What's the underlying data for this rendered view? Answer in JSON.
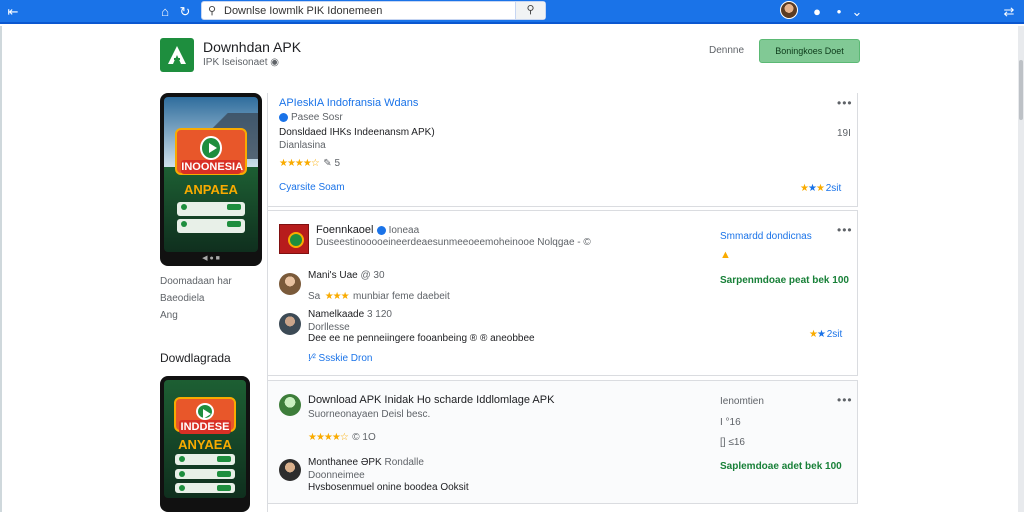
{
  "browser": {
    "back_icon": "back-arrow-icon",
    "search_query": "Downlse Iowmlk PIK Idonemeen",
    "search_icon": "search-icon"
  },
  "header": {
    "app_title": "Downhdan APK",
    "app_subtitle": "IPK Iseisonaet",
    "developer_label": "Dennne",
    "install_label": "Boningkoes Doet"
  },
  "sidebar": {
    "phone1": {
      "badge_text": "INOONESIA",
      "bottom_text": "ANPAEA"
    },
    "phone2": {
      "badge_text": "INDDESE",
      "bottom_text": "ANYAEA"
    },
    "meta": [
      "Doomadaan har",
      "Baeodiela",
      "Ang"
    ],
    "downloads_heading": "Dowdlagrada"
  },
  "card1": {
    "title": "APIeskIA Indofransia Wdans",
    "tag": "Pasee Sosr",
    "subtitle": "Donsldaed IHKs Indeenansm APK)",
    "detail": "Dianlasina",
    "rating_count": "5",
    "link": "Cyarsite Soam",
    "size": "19I",
    "score_label": "2sit"
  },
  "card2": {
    "publisher": "Foennkaoel",
    "publisher_tag": "Ioneaa",
    "description": "Duseestinooooeineerdeaesunmeeoeemoheinooe Nolqgae - ©",
    "side_label": "Smmardd dondicnas",
    "reviews": [
      {
        "name": "Mani's Uae",
        "meta": "@ 30",
        "stars_text": "Sa",
        "text": "munbiar feme daebeit"
      },
      {
        "name": "Namelkaade",
        "meta": "3 120",
        "sub": "Dorllesse",
        "text": "Dee ee ne penneiingere fooanbeing ® ® aneobbee"
      }
    ],
    "link": "!⁄² Ssskie Dron",
    "green_text": "Sarpenmdoae peat bek 100",
    "score_label": "2sit"
  },
  "card3": {
    "title": "Download APK Inidak Ho scharde Iddlomlage APK",
    "subtitle": "Suorneonayaen Deisl besc.",
    "rating_count": "© 1O",
    "side_label": "Ienomtien",
    "side_meta1": "I °16",
    "side_meta2": "[] ≤16",
    "reviewer_name": "Monthanee ƏPK",
    "reviewer_tag": "Rondalle",
    "reviewer_sub": "Doonneimee",
    "reviewer_text": "Hvsbosenmuel onine boodea Ooksit",
    "green_text": "Saplemdoae adet bek 100"
  }
}
